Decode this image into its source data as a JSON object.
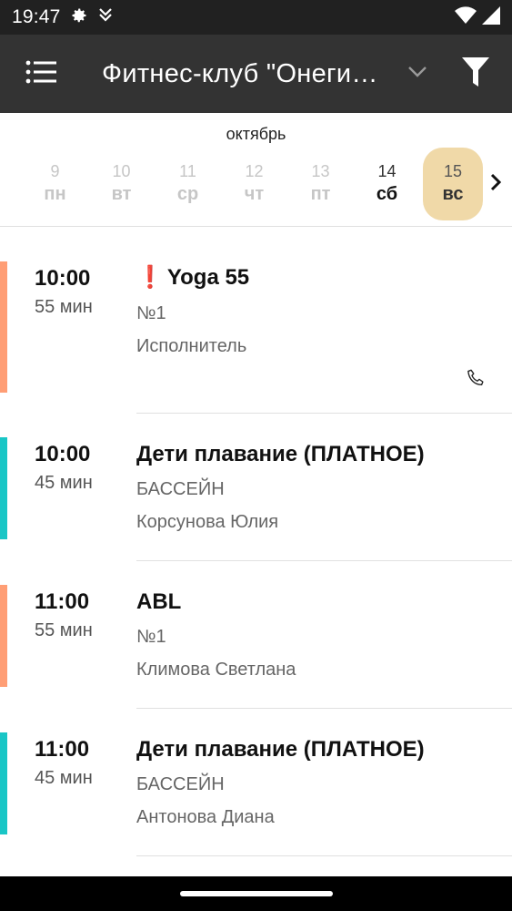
{
  "status_bar": {
    "time": "19:47"
  },
  "app_bar": {
    "title": "Фитнес-клуб \"Онеги…"
  },
  "calendar": {
    "month": "октябрь",
    "days": [
      {
        "num": "9",
        "dow": "пн"
      },
      {
        "num": "10",
        "dow": "вт"
      },
      {
        "num": "11",
        "dow": "ср"
      },
      {
        "num": "12",
        "dow": "чт"
      },
      {
        "num": "13",
        "dow": "пт"
      },
      {
        "num": "14",
        "dow": "сб"
      },
      {
        "num": "15",
        "dow": "вс"
      }
    ],
    "selected_index": 6
  },
  "schedule": [
    {
      "time": "10:00",
      "duration": "55 мин",
      "alert": "❗",
      "title": "Yoga 55",
      "room": "№1",
      "trainer": "Исполнитель",
      "color": "#ff9e75",
      "has_phone": true
    },
    {
      "time": "10:00",
      "duration": "45 мин",
      "title": "Дети плавание (ПЛАТНОЕ)",
      "room": "БАССЕЙН",
      "trainer": "Корсунова Юлия",
      "color": "#19c6c6"
    },
    {
      "time": "11:00",
      "duration": "55 мин",
      "title": "ABL",
      "room": "№1",
      "trainer": "Климова Светлана",
      "color": "#ff9e75"
    },
    {
      "time": "11:00",
      "duration": "45 мин",
      "title": "Дети плавание (ПЛАТНОЕ)",
      "room": "БАССЕЙН",
      "trainer": "Антонова Диана",
      "color": "#19c6c6"
    }
  ],
  "icons": {
    "menu": "hamburger-icon",
    "dropdown": "chevron-down-icon",
    "filter": "filter-icon",
    "next": "chevron-right-icon",
    "phone": "phone-icon"
  }
}
